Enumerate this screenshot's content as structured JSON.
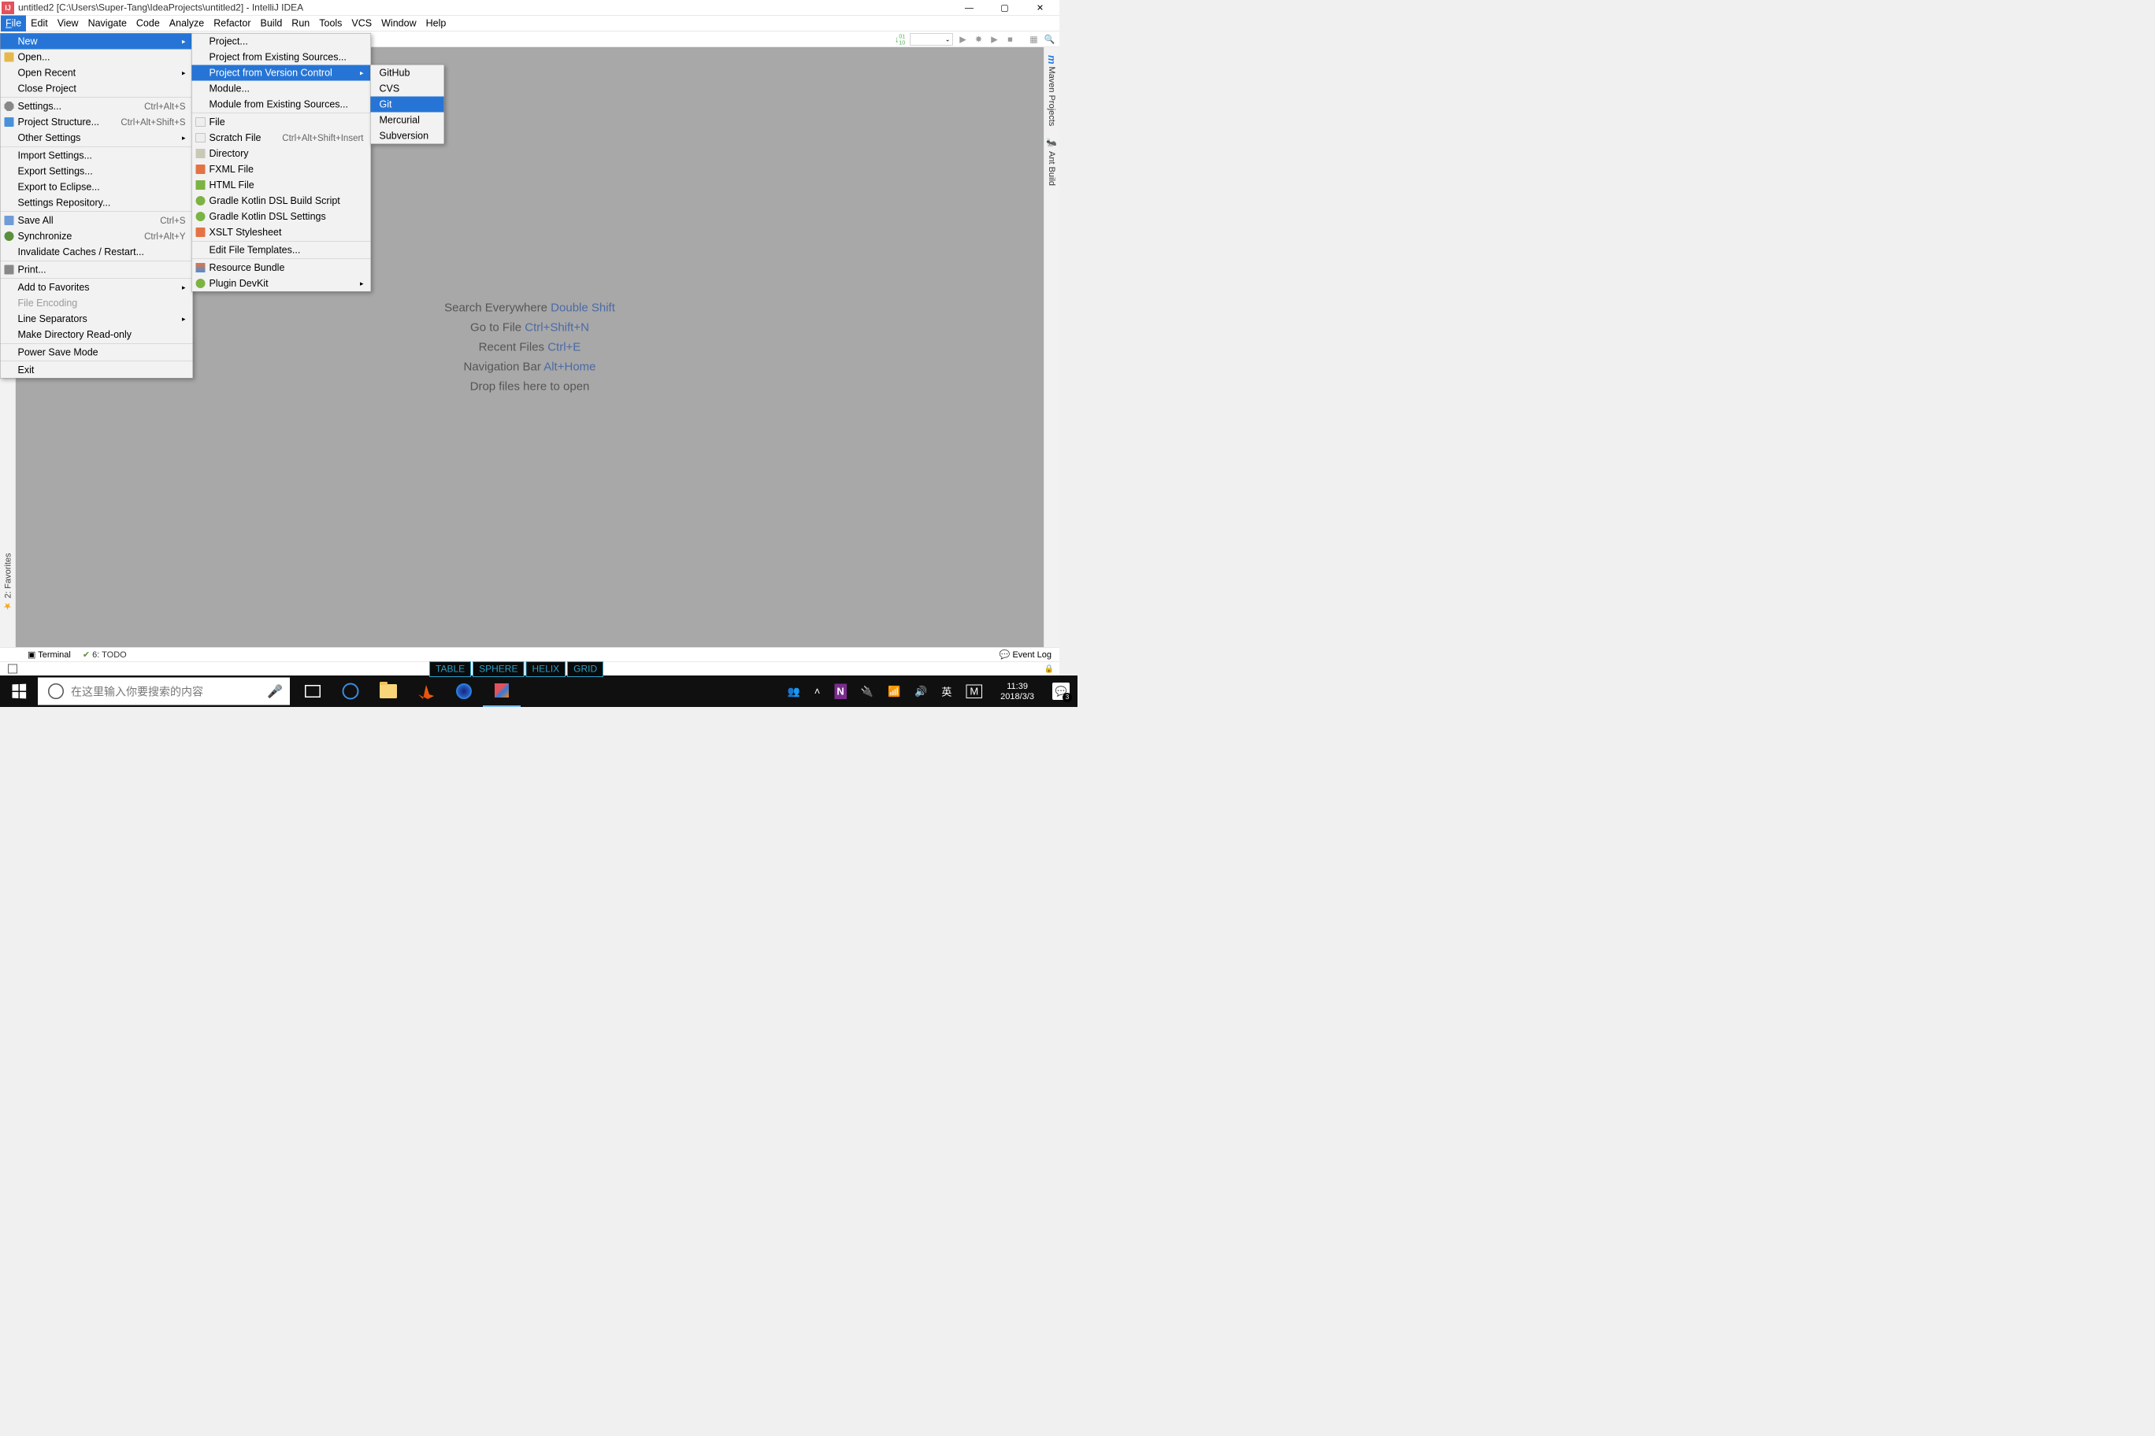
{
  "titlebar": {
    "title": "untitled2 [C:\\Users\\Super-Tang\\IdeaProjects\\untitled2] - IntelliJ IDEA"
  },
  "menubar": {
    "items": [
      "File",
      "Edit",
      "View",
      "Navigate",
      "Code",
      "Analyze",
      "Refactor",
      "Build",
      "Run",
      "Tools",
      "VCS",
      "Window",
      "Help"
    ]
  },
  "file_menu": {
    "new": "New",
    "open": "Open...",
    "open_recent": "Open Recent",
    "close_project": "Close Project",
    "settings": "Settings...",
    "settings_sc": "Ctrl+Alt+S",
    "project_structure": "Project Structure...",
    "project_structure_sc": "Ctrl+Alt+Shift+S",
    "other_settings": "Other Settings",
    "import_settings": "Import Settings...",
    "export_settings": "Export Settings...",
    "export_eclipse": "Export to Eclipse...",
    "settings_repo": "Settings Repository...",
    "save_all": "Save All",
    "save_all_sc": "Ctrl+S",
    "synchronize": "Synchronize",
    "synchronize_sc": "Ctrl+Alt+Y",
    "invalidate": "Invalidate Caches / Restart...",
    "print": "Print...",
    "add_favorites": "Add to Favorites",
    "file_encoding": "File Encoding",
    "line_separators": "Line Separators",
    "make_readonly": "Make Directory Read-only",
    "power_save": "Power Save Mode",
    "exit": "Exit"
  },
  "new_menu": {
    "project": "Project...",
    "project_existing": "Project from Existing Sources...",
    "project_vc": "Project from Version Control",
    "module": "Module...",
    "module_existing": "Module from Existing Sources...",
    "file": "File",
    "scratch": "Scratch File",
    "scratch_sc": "Ctrl+Alt+Shift+Insert",
    "directory": "Directory",
    "fxml": "FXML File",
    "html": "HTML File",
    "gradle_kotlin_build": "Gradle Kotlin DSL Build Script",
    "gradle_kotlin_settings": "Gradle Kotlin DSL Settings",
    "xslt": "XSLT Stylesheet",
    "edit_templates": "Edit File Templates...",
    "resource_bundle": "Resource Bundle",
    "plugin_devkit": "Plugin DevKit"
  },
  "vc_menu": {
    "github": "GitHub",
    "cvs": "CVS",
    "git": "Git",
    "mercurial": "Mercurial",
    "subversion": "Subversion"
  },
  "hints": {
    "search": "Search Everywhere ",
    "search_key": "Double Shift",
    "gotofile": "Go to File ",
    "gotofile_key": "Ctrl+Shift+N",
    "recent": "Recent Files ",
    "recent_key": "Ctrl+E",
    "navbar": "Navigation Bar ",
    "navbar_key": "Alt+Home",
    "drop": "Drop files here to open"
  },
  "right_tabs": {
    "maven": "Maven Projects",
    "ant": "Ant Build"
  },
  "left_tabs": {
    "favorites": "2: Favorites"
  },
  "bottom": {
    "terminal": "Terminal",
    "todo": "6: TODO",
    "eventlog": "Event Log"
  },
  "app_tabs": {
    "table": "TABLE",
    "sphere": "SPHERE",
    "helix": "HELIX",
    "grid": "GRID"
  },
  "taskbar": {
    "search_placeholder": "在这里输入你要搜索的内容",
    "ime1": "英",
    "ime2": "M",
    "time": "11:39",
    "date": "2018/3/3",
    "notif_count": "3"
  }
}
